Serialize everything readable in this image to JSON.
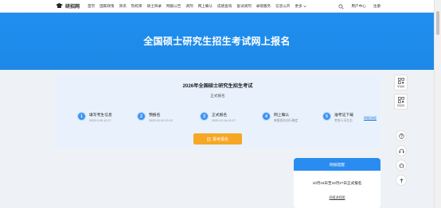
{
  "header": {
    "logo_text": "研招网",
    "nav": [
      "首页",
      "国家政策",
      "资讯",
      "院校库",
      "硕士目录",
      "网报公告",
      "调剂",
      "网上确认",
      "成绩查询",
      "复试调剂",
      "录取服务",
      "信息公开"
    ],
    "more_label": "更多",
    "user_center": "用户中心",
    "register": "注册"
  },
  "banner": {
    "title": "全国硕士研究生招生考试网上报名"
  },
  "exam": {
    "title": "2026年全国硕士研究生招生考试",
    "status": "正式报名",
    "steps": [
      {
        "num": "1",
        "title": "填写考生信息",
        "date": "2025.9.30-10.27"
      },
      {
        "num": "2",
        "title": "预报名",
        "date": "2025.10.10-10.13"
      },
      {
        "num": "3",
        "title": "正式报名",
        "date": "2025.10.16-10.27"
      },
      {
        "num": "4",
        "title": "网上确认",
        "date": "每报招办自行确定"
      },
      {
        "num": "5",
        "title": "准考证下载",
        "date": "考前十天左右"
      }
    ],
    "flow_link": "网报流程",
    "apply_button": "报考报名"
  },
  "notice": {
    "header": "网报提醒",
    "body": "10月16日至10月27日正式报名",
    "link": "网报流程图"
  },
  "side": {
    "qr1_label": "学信网",
    "qr2_label": "研招网"
  },
  "colors": {
    "primary": "#1e88e5",
    "accent": "#f6a723",
    "card_bg": "#e9f2fc"
  }
}
